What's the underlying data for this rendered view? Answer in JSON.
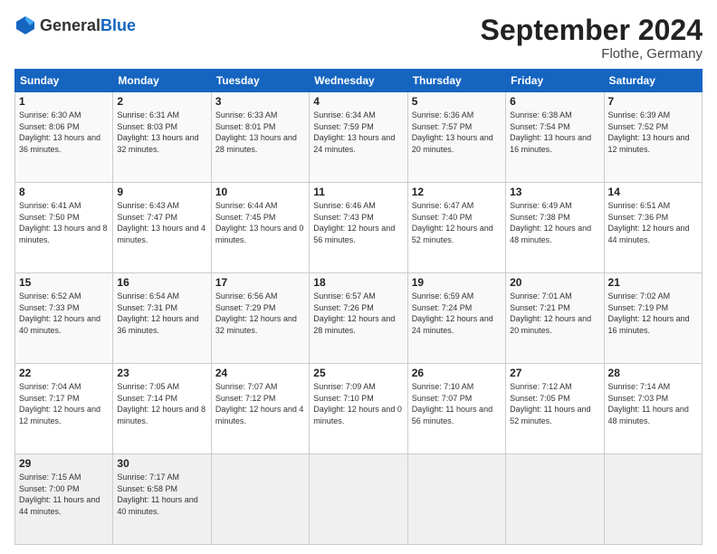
{
  "logo": {
    "general": "General",
    "blue": "Blue"
  },
  "header": {
    "month": "September 2024",
    "location": "Flothe, Germany"
  },
  "weekdays": [
    "Sunday",
    "Monday",
    "Tuesday",
    "Wednesday",
    "Thursday",
    "Friday",
    "Saturday"
  ],
  "weeks": [
    [
      {
        "day": "1",
        "sunrise": "6:30 AM",
        "sunset": "8:06 PM",
        "daylight": "13 hours and 36 minutes."
      },
      {
        "day": "2",
        "sunrise": "6:31 AM",
        "sunset": "8:03 PM",
        "daylight": "13 hours and 32 minutes."
      },
      {
        "day": "3",
        "sunrise": "6:33 AM",
        "sunset": "8:01 PM",
        "daylight": "13 hours and 28 minutes."
      },
      {
        "day": "4",
        "sunrise": "6:34 AM",
        "sunset": "7:59 PM",
        "daylight": "13 hours and 24 minutes."
      },
      {
        "day": "5",
        "sunrise": "6:36 AM",
        "sunset": "7:57 PM",
        "daylight": "13 hours and 20 minutes."
      },
      {
        "day": "6",
        "sunrise": "6:38 AM",
        "sunset": "7:54 PM",
        "daylight": "13 hours and 16 minutes."
      },
      {
        "day": "7",
        "sunrise": "6:39 AM",
        "sunset": "7:52 PM",
        "daylight": "13 hours and 12 minutes."
      }
    ],
    [
      {
        "day": "8",
        "sunrise": "6:41 AM",
        "sunset": "7:50 PM",
        "daylight": "13 hours and 8 minutes."
      },
      {
        "day": "9",
        "sunrise": "6:43 AM",
        "sunset": "7:47 PM",
        "daylight": "13 hours and 4 minutes."
      },
      {
        "day": "10",
        "sunrise": "6:44 AM",
        "sunset": "7:45 PM",
        "daylight": "13 hours and 0 minutes."
      },
      {
        "day": "11",
        "sunrise": "6:46 AM",
        "sunset": "7:43 PM",
        "daylight": "12 hours and 56 minutes."
      },
      {
        "day": "12",
        "sunrise": "6:47 AM",
        "sunset": "7:40 PM",
        "daylight": "12 hours and 52 minutes."
      },
      {
        "day": "13",
        "sunrise": "6:49 AM",
        "sunset": "7:38 PM",
        "daylight": "12 hours and 48 minutes."
      },
      {
        "day": "14",
        "sunrise": "6:51 AM",
        "sunset": "7:36 PM",
        "daylight": "12 hours and 44 minutes."
      }
    ],
    [
      {
        "day": "15",
        "sunrise": "6:52 AM",
        "sunset": "7:33 PM",
        "daylight": "12 hours and 40 minutes."
      },
      {
        "day": "16",
        "sunrise": "6:54 AM",
        "sunset": "7:31 PM",
        "daylight": "12 hours and 36 minutes."
      },
      {
        "day": "17",
        "sunrise": "6:56 AM",
        "sunset": "7:29 PM",
        "daylight": "12 hours and 32 minutes."
      },
      {
        "day": "18",
        "sunrise": "6:57 AM",
        "sunset": "7:26 PM",
        "daylight": "12 hours and 28 minutes."
      },
      {
        "day": "19",
        "sunrise": "6:59 AM",
        "sunset": "7:24 PM",
        "daylight": "12 hours and 24 minutes."
      },
      {
        "day": "20",
        "sunrise": "7:01 AM",
        "sunset": "7:21 PM",
        "daylight": "12 hours and 20 minutes."
      },
      {
        "day": "21",
        "sunrise": "7:02 AM",
        "sunset": "7:19 PM",
        "daylight": "12 hours and 16 minutes."
      }
    ],
    [
      {
        "day": "22",
        "sunrise": "7:04 AM",
        "sunset": "7:17 PM",
        "daylight": "12 hours and 12 minutes."
      },
      {
        "day": "23",
        "sunrise": "7:05 AM",
        "sunset": "7:14 PM",
        "daylight": "12 hours and 8 minutes."
      },
      {
        "day": "24",
        "sunrise": "7:07 AM",
        "sunset": "7:12 PM",
        "daylight": "12 hours and 4 minutes."
      },
      {
        "day": "25",
        "sunrise": "7:09 AM",
        "sunset": "7:10 PM",
        "daylight": "12 hours and 0 minutes."
      },
      {
        "day": "26",
        "sunrise": "7:10 AM",
        "sunset": "7:07 PM",
        "daylight": "11 hours and 56 minutes."
      },
      {
        "day": "27",
        "sunrise": "7:12 AM",
        "sunset": "7:05 PM",
        "daylight": "11 hours and 52 minutes."
      },
      {
        "day": "28",
        "sunrise": "7:14 AM",
        "sunset": "7:03 PM",
        "daylight": "11 hours and 48 minutes."
      }
    ],
    [
      {
        "day": "29",
        "sunrise": "7:15 AM",
        "sunset": "7:00 PM",
        "daylight": "11 hours and 44 minutes."
      },
      {
        "day": "30",
        "sunrise": "7:17 AM",
        "sunset": "6:58 PM",
        "daylight": "11 hours and 40 minutes."
      },
      {
        "day": "",
        "sunrise": "",
        "sunset": "",
        "daylight": ""
      },
      {
        "day": "",
        "sunrise": "",
        "sunset": "",
        "daylight": ""
      },
      {
        "day": "",
        "sunrise": "",
        "sunset": "",
        "daylight": ""
      },
      {
        "day": "",
        "sunrise": "",
        "sunset": "",
        "daylight": ""
      },
      {
        "day": "",
        "sunrise": "",
        "sunset": "",
        "daylight": ""
      }
    ]
  ]
}
